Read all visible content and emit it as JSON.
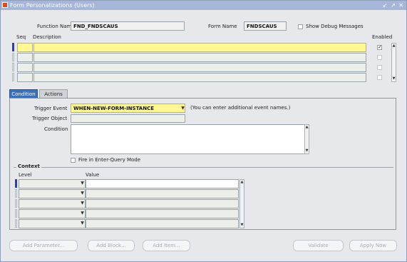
{
  "window": {
    "title": "Form Personalizations (Users)",
    "controls": "↙ ↗ ✕"
  },
  "header": {
    "function_name_label": "Function Name",
    "function_name_value": "FND_FNDSCAUS",
    "form_name_label": "Form Name",
    "form_name_value": "FNDSCAUS",
    "show_debug_label": "Show Debug Messages",
    "show_debug_checked": false
  },
  "rules": {
    "seq_header": "Seq",
    "description_header": "Description",
    "enabled_header": "Enabled",
    "rows": [
      {
        "seq": "",
        "description": "",
        "enabled": true
      },
      {
        "seq": "",
        "description": "",
        "enabled": false
      },
      {
        "seq": "",
        "description": "",
        "enabled": false
      },
      {
        "seq": "",
        "description": "",
        "enabled": false
      }
    ]
  },
  "tabs": [
    {
      "label": "Condition",
      "active": true
    },
    {
      "label": "Actions",
      "active": false
    }
  ],
  "condition": {
    "trigger_event_label": "Trigger Event",
    "trigger_event_value": "WHEN-NEW-FORM-INSTANCE",
    "trigger_event_hint": "(You can enter additional event names.)",
    "trigger_object_label": "Trigger Object",
    "trigger_object_value": "",
    "condition_label": "Condition",
    "condition_value": "",
    "fire_query_label": "Fire in Enter-Query Mode",
    "fire_query_checked": false
  },
  "context": {
    "section_label": "Context",
    "level_header": "Level",
    "value_header": "Value",
    "rows": [
      {
        "level": "",
        "value": ""
      },
      {
        "level": "",
        "value": ""
      },
      {
        "level": "",
        "value": ""
      },
      {
        "level": "",
        "value": ""
      },
      {
        "level": "",
        "value": ""
      }
    ]
  },
  "buttons": {
    "add_parameter": "Add Parameter...",
    "add_block": "Add Block...",
    "add_item": "Add Item...",
    "validate": "Validate",
    "apply_now": "Apply Now"
  },
  "colors": {
    "title_bar": "#a6b6d8",
    "tab_active": "#3b6fb6",
    "current_row": "#fff895",
    "record_marker": "#2a3fb0"
  }
}
